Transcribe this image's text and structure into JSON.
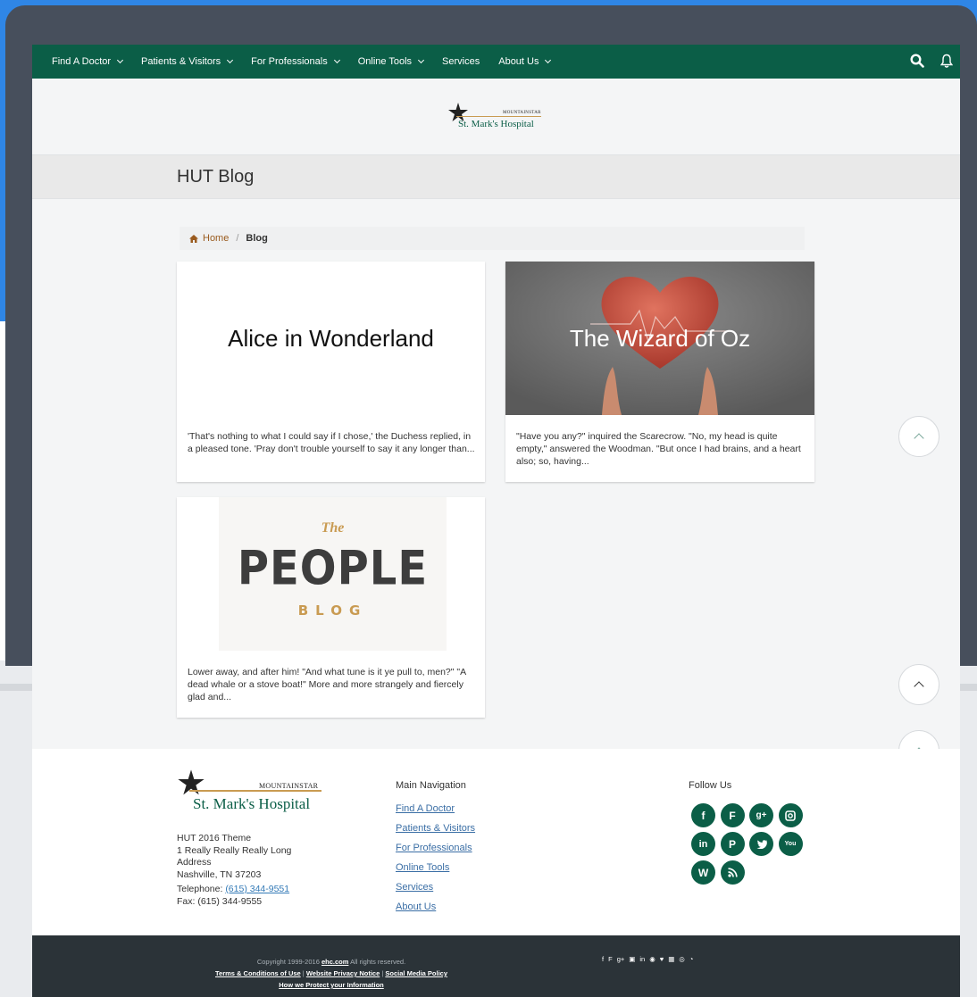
{
  "nav": {
    "items": [
      {
        "label": "Find A Doctor",
        "dropdown": true
      },
      {
        "label": "Patients & Visitors",
        "dropdown": true
      },
      {
        "label": "For Professionals",
        "dropdown": true
      },
      {
        "label": "Online Tools",
        "dropdown": true
      },
      {
        "label": "Services",
        "dropdown": false
      },
      {
        "label": "About Us",
        "dropdown": true
      }
    ],
    "icons": [
      "search-icon",
      "bell-icon"
    ]
  },
  "logo": {
    "brand_top": "MOUNTAINSTAR",
    "brand_main": "St. Mark's Hospital"
  },
  "page": {
    "title": "HUT Blog"
  },
  "breadcrumb": {
    "home": "Home",
    "current": "Blog"
  },
  "posts": [
    {
      "title": "Alice in Wonderland",
      "excerpt": "'That's nothing to what I could say if I chose,' the Duchess replied, in a pleased tone. 'Pray don't trouble yourself to say it any longer than..."
    },
    {
      "title": "The Wizard of Oz",
      "excerpt": "\"Have you any?\" inquired the Scarecrow. \"No, my head is quite empty,\" answered the Woodman. \"But once I had brains, and a heart also; so, having..."
    },
    {
      "title": "",
      "image_text": {
        "the": "The",
        "people": "PEOPLE",
        "blog": "BLOG"
      },
      "excerpt": "Lower away, and after him! \"And what tune is it ye pull to, men?\" \"A dead whale or a stove boat!\" More and more strangely and fiercely glad and..."
    }
  ],
  "footer": {
    "address": [
      "HUT 2016 Theme",
      "1 Really Really Really Long",
      "Address",
      "Nashville, TN 37203"
    ],
    "telephone_label": "Telephone:",
    "telephone": "(615) 344-9551",
    "fax": "Fax: (615) 344-9555",
    "main_nav_heading": "Main Navigation",
    "main_nav": [
      "Find A Doctor",
      "Patients & Visitors",
      "For Professionals",
      "Online Tools",
      "Services",
      "About Us"
    ],
    "follow_heading": "Follow Us",
    "social": [
      "facebook-icon",
      "foursquare-icon",
      "google-plus-icon",
      "instagram-icon",
      "linkedin-icon",
      "pinterest-icon",
      "twitter-icon",
      "youtube-icon",
      "wordpress-icon",
      "rss-icon"
    ]
  },
  "bottom": {
    "copyright_prefix": "Copyright 1999-2016",
    "copyright_link": "ehc.com",
    "copyright_suffix": "All rights reserved.",
    "terms": "Terms & Conditions of Use",
    "privacy": "Website Privacy Notice",
    "social_policy": "Social Media Policy",
    "protect": "How we Protect your Information",
    "separator": "|"
  },
  "colors": {
    "brand_green": "#0b5e47",
    "footer_dark": "#2b3338",
    "accent_gold": "#c99b52"
  }
}
